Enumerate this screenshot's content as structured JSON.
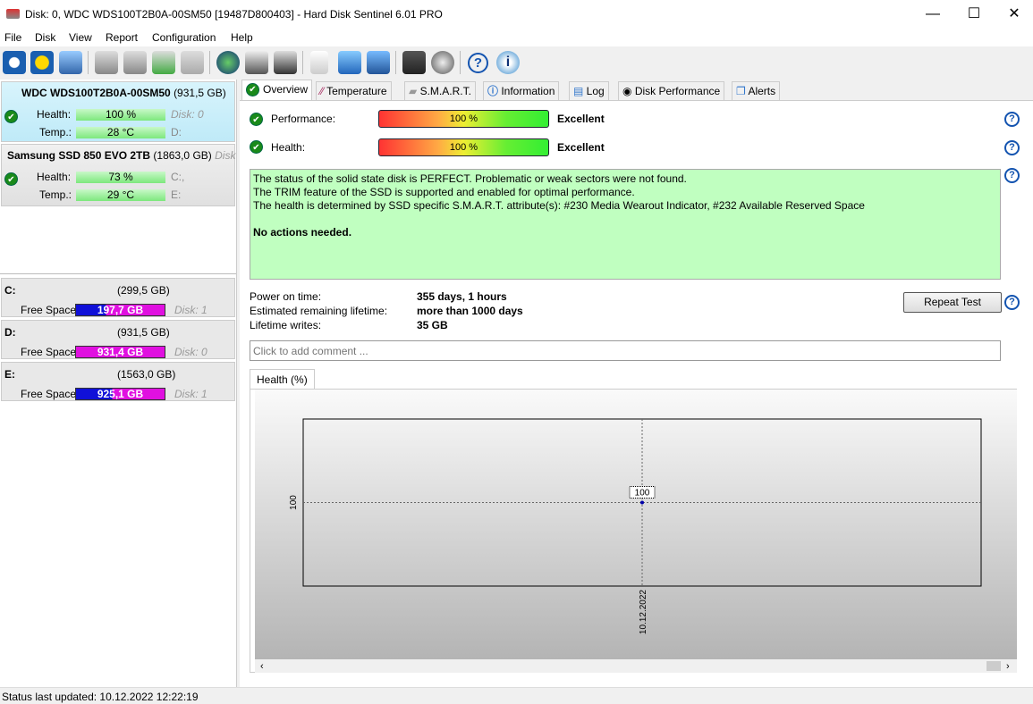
{
  "window": {
    "title": "Disk: 0, WDC  WDS100T2B0A-00SM50 [19487D800403]  -  Hard Disk Sentinel 6.01 PRO",
    "minimize": "—",
    "maximize": "☐",
    "close": "✕"
  },
  "menu": [
    "File",
    "Disk",
    "View",
    "Report",
    "Configuration",
    "Help"
  ],
  "toolbar": [
    "refresh-icon",
    "alert-refresh-icon",
    "disk-icon",
    "disk-settings-icon",
    "disk-clock-icon",
    "disk-check-icon",
    "disk-search-icon",
    "web-icon",
    "disk-print-icon",
    "server-icon",
    "report-icon",
    "send-icon",
    "network-icon",
    "monitor-icon",
    "speaker-icon",
    "help-icon",
    "info-icon"
  ],
  "disks": [
    {
      "name": "WDC  WDS100T2B0A-00SM50",
      "size": "(931,5 GB)",
      "health_label": "Health:",
      "health": "100 %",
      "temp_label": "Temp.:",
      "temp": "28 °C",
      "disk": "Disk: 0",
      "drives": "D:"
    },
    {
      "name": "Samsung SSD 850 EVO 2TB",
      "size": "(1863,0 GB)",
      "disk": "Disk",
      "health_label": "Health:",
      "health": "73 %",
      "temp_label": "Temp.:",
      "temp": "29 °C",
      "drives_1": "C:,",
      "drives_2": "E:"
    }
  ],
  "volumes": [
    {
      "letter": "C:",
      "size": "(299,5 GB)",
      "label": "Free Space",
      "free": "197,7 GB",
      "disk": "Disk: 1",
      "free_pct": 66
    },
    {
      "letter": "D:",
      "size": "(931,5 GB)",
      "label": "Free Space",
      "free": "931,4 GB",
      "disk": "Disk: 0",
      "free_pct": 100
    },
    {
      "letter": "E:",
      "size": "(1563,0 GB)",
      "label": "Free Space",
      "free": "925,1 GB",
      "disk": "Disk: 1",
      "free_pct": 59
    }
  ],
  "tabs": [
    "Overview",
    "Temperature",
    "S.M.A.R.T.",
    "Information",
    "Log",
    "Disk Performance",
    "Alerts"
  ],
  "overview": {
    "performance_label": "Performance:",
    "performance": "100 %",
    "performance_rating": "Excellent",
    "health_label": "Health:",
    "health": "100 %",
    "health_rating": "Excellent",
    "status_lines": [
      "The status of the solid state disk is PERFECT. Problematic or weak sectors were not found.",
      "The TRIM feature of the SSD is supported and enabled for optimal performance.",
      "The health is determined by SSD specific S.M.A.R.T. attribute(s):  #230 Media Wearout Indicator, #232 Available Reserved Space"
    ],
    "status_action": "No actions needed.",
    "power_on_label": "Power on time:",
    "power_on": "355 days, 1 hours",
    "remaining_label": "Estimated remaining lifetime:",
    "remaining": "more than 1000 days",
    "writes_label": "Lifetime writes:",
    "writes": "35 GB",
    "repeat_test": "Repeat Test",
    "comment_placeholder": "Click to add comment ...",
    "chart_tab": "Health (%)"
  },
  "chart_data": {
    "type": "line",
    "x": [
      "10.12.2022"
    ],
    "values": [
      100
    ],
    "ytick": "100",
    "point_label": "100",
    "grid": true
  },
  "status_bar": "Status last updated: 10.12.2022 12:22:19"
}
